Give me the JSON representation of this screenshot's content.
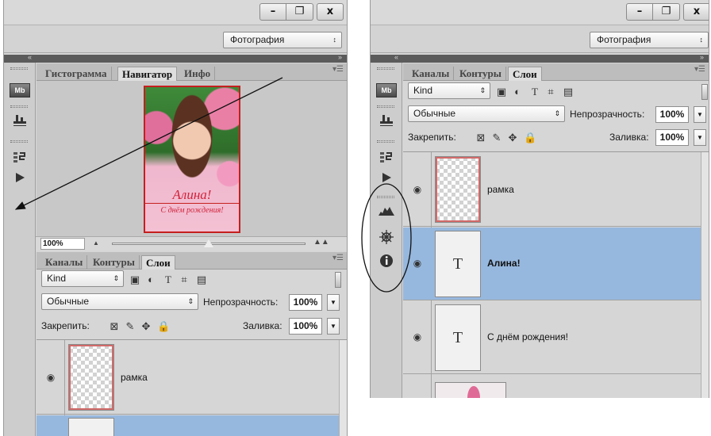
{
  "window_controls": {
    "minimize": "–",
    "maximize": "❐",
    "close": "x"
  },
  "workspace": {
    "label": "Фотография",
    "arrow": "↕"
  },
  "collapse": {
    "left": "«",
    "right": "»"
  },
  "tool_icons": [
    "mb-icon",
    "brush-settings-icon",
    "history-icon",
    "actions-play-icon",
    "histogram-icon",
    "navigator-icon",
    "info-icon"
  ],
  "left_panel": {
    "tabs": [
      "Гистограмма",
      "Навигатор",
      "Инфо"
    ],
    "active_tab": "Навигатор",
    "photo_caption": "Алина!",
    "photo_subcaption": "С днём рождения!",
    "zoom": "100%"
  },
  "layers_panel": {
    "tabs": [
      "Каналы",
      "Контуры",
      "Слои"
    ],
    "active_tab": "Слои",
    "filter_kind": "Kind",
    "blend_mode": "Обычные",
    "opacity_label": "Непрозрачность:",
    "opacity_value": "100%",
    "lock_label": "Закрепить:",
    "fill_label": "Заливка:",
    "fill_value": "100%",
    "text_thumb_glyph": "T",
    "layers": [
      {
        "name": "рамка",
        "type": "frame",
        "visible": true,
        "selected": false
      },
      {
        "name": "Алина!",
        "type": "text",
        "visible": true,
        "selected": true
      },
      {
        "name": "С днём рождения!",
        "type": "text",
        "visible": true,
        "selected": false
      }
    ]
  },
  "colors": {
    "selected_layer": "#97b8de",
    "frame_red": "#c51f1f",
    "panel_bg": "#d6d6d6"
  }
}
